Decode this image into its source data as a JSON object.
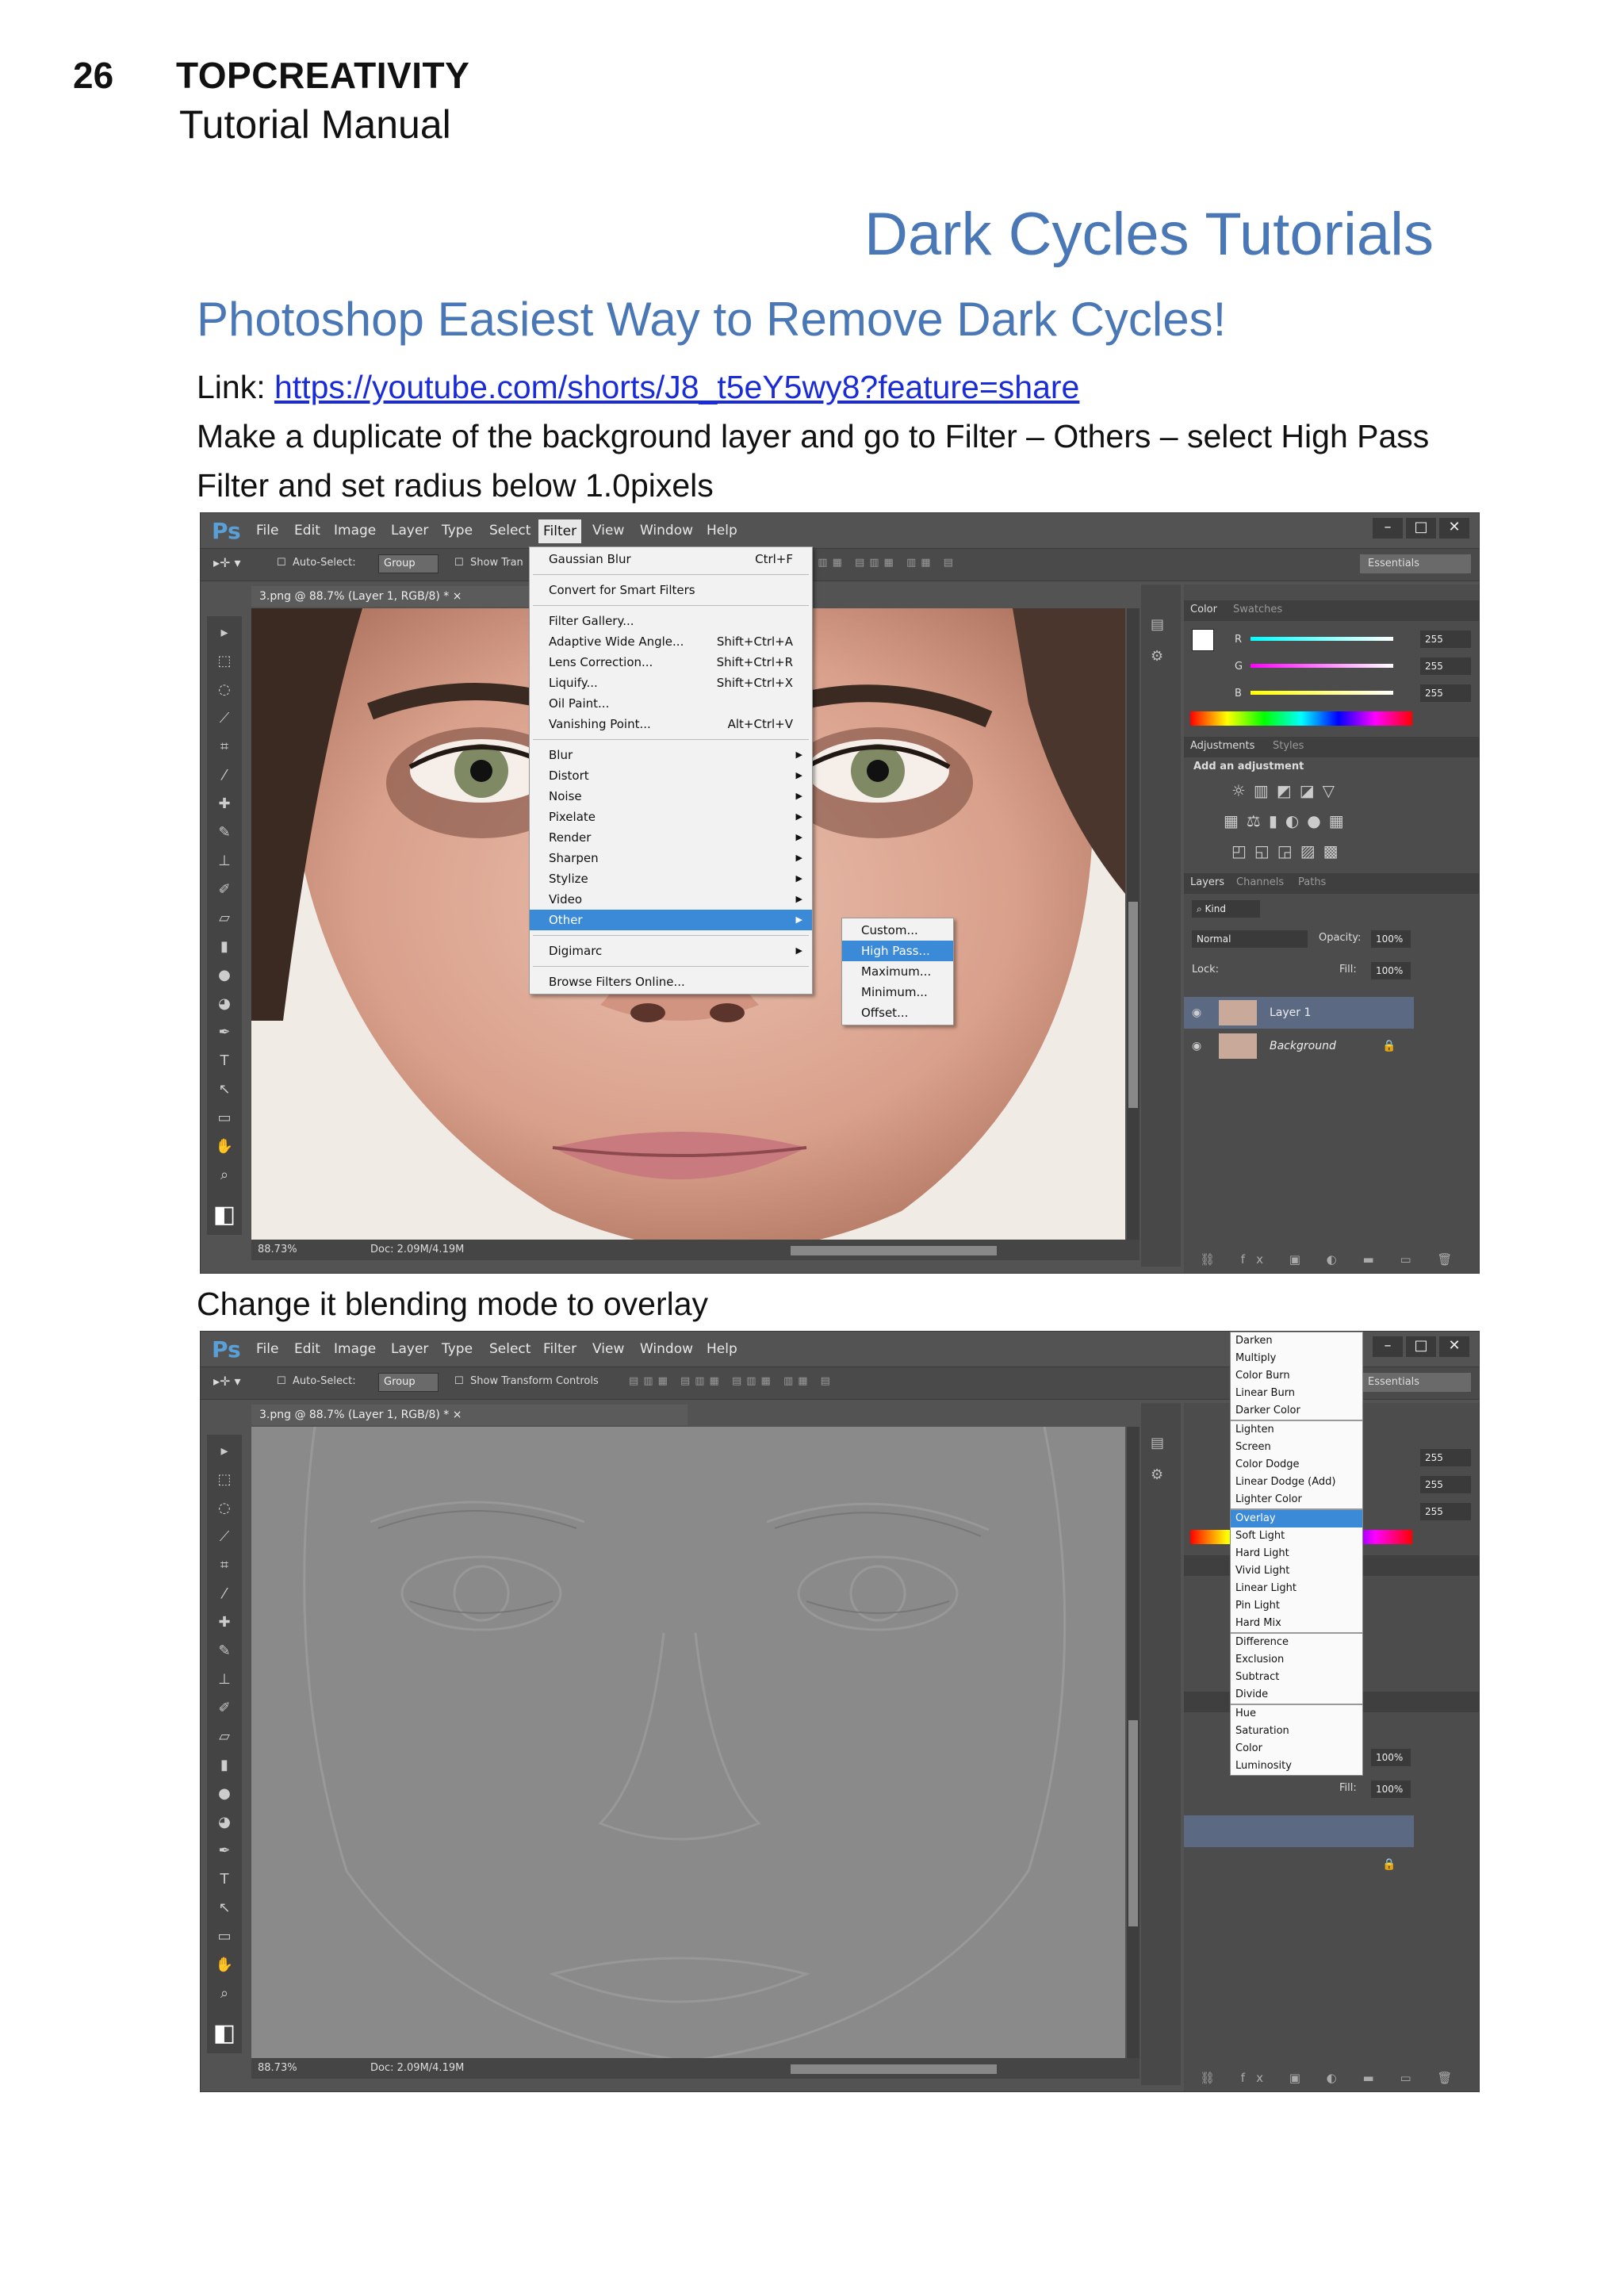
{
  "page": {
    "number": "26",
    "brand": "TOPCREATIVITY",
    "subtitle": "Tutorial Manual",
    "section_title": "Dark Cycles Tutorials",
    "article_title": "Photoshop Easiest Way to Remove Dark Cycles!",
    "link_label": "Link: ",
    "link_url": "https://youtube.com/shorts/J8_t5eY5wy8?feature=share",
    "step1_line1": "Make a duplicate of the background layer and go to Filter – Others – select High Pass",
    "step1_line2": "Filter and set radius below 1.0pixels",
    "step2": "Change it blending mode to overlay"
  },
  "ps": {
    "logo": "Ps",
    "menus": [
      "File",
      "Edit",
      "Image",
      "Layer",
      "Type",
      "Select",
      "Filter",
      "View",
      "Window",
      "Help"
    ],
    "window_buttons": [
      "–",
      "□",
      "✕"
    ],
    "options": {
      "auto_select": "Auto-Select:",
      "group": "Group",
      "show_transform": "Show Transform Controls",
      "show_trans_short": "Show Tran",
      "essentials": "Essentials"
    },
    "doc_tab": "3.png @ 88.7% (Layer 1, RGB/8) *",
    "zoom": "88.73%",
    "doc_size": "Doc: 2.09M/4.19M",
    "panels": {
      "color_tab": "Color",
      "swatches_tab": "Swatches",
      "rgb_labels": [
        "R",
        "G",
        "B"
      ],
      "rgb_values": [
        "255",
        "255",
        "255"
      ],
      "adjustments_tab": "Adjustments",
      "styles_tab": "Styles",
      "add_adjustment": "Add an adjustment",
      "layers_tab": "Layers",
      "channels_tab": "Channels",
      "paths_tab": "Paths",
      "kind": "Kind",
      "blend_mode": "Normal",
      "opacity_label": "Opacity:",
      "opacity": "100%",
      "lock_label": "Lock:",
      "fill_label": "Fill:",
      "fill": "100%",
      "layers": [
        "Layer 1",
        "Background"
      ]
    },
    "filter_menu": {
      "items": [
        {
          "label": "Gaussian Blur",
          "shortcut": "Ctrl+F"
        },
        {
          "sep": true
        },
        {
          "label": "Convert for Smart Filters"
        },
        {
          "sep": true
        },
        {
          "label": "Filter Gallery..."
        },
        {
          "label": "Adaptive Wide Angle...",
          "shortcut": "Shift+Ctrl+A"
        },
        {
          "label": "Lens Correction...",
          "shortcut": "Shift+Ctrl+R"
        },
        {
          "label": "Liquify...",
          "shortcut": "Shift+Ctrl+X"
        },
        {
          "label": "Oil Paint..."
        },
        {
          "label": "Vanishing Point...",
          "shortcut": "Alt+Ctrl+V"
        },
        {
          "sep": true
        },
        {
          "label": "Blur",
          "sub": true
        },
        {
          "label": "Distort",
          "sub": true
        },
        {
          "label": "Noise",
          "sub": true
        },
        {
          "label": "Pixelate",
          "sub": true
        },
        {
          "label": "Render",
          "sub": true
        },
        {
          "label": "Sharpen",
          "sub": true
        },
        {
          "label": "Stylize",
          "sub": true
        },
        {
          "label": "Video",
          "sub": true
        },
        {
          "label": "Other",
          "sub": true,
          "hl": true
        },
        {
          "sep": true
        },
        {
          "label": "Digimarc",
          "sub": true
        },
        {
          "sep": true
        },
        {
          "label": "Browse Filters Online..."
        }
      ],
      "other_submenu": [
        {
          "label": "Custom..."
        },
        {
          "label": "High Pass...",
          "hl": true
        },
        {
          "label": "Maximum..."
        },
        {
          "label": "Minimum..."
        },
        {
          "label": "Offset..."
        }
      ]
    },
    "blend_menu": [
      {
        "label": "Darken"
      },
      {
        "label": "Multiply"
      },
      {
        "label": "Color Burn"
      },
      {
        "label": "Linear Burn"
      },
      {
        "label": "Darker Color"
      },
      {
        "sep": true
      },
      {
        "label": "Lighten"
      },
      {
        "label": "Screen"
      },
      {
        "label": "Color Dodge"
      },
      {
        "label": "Linear Dodge (Add)"
      },
      {
        "label": "Lighter Color"
      },
      {
        "sep": true
      },
      {
        "label": "Overlay",
        "hl": true
      },
      {
        "label": "Soft Light"
      },
      {
        "label": "Hard Light"
      },
      {
        "label": "Vivid Light"
      },
      {
        "label": "Linear Light"
      },
      {
        "label": "Pin Light"
      },
      {
        "label": "Hard Mix"
      },
      {
        "sep": true
      },
      {
        "label": "Difference"
      },
      {
        "label": "Exclusion"
      },
      {
        "label": "Subtract"
      },
      {
        "label": "Divide"
      },
      {
        "sep": true
      },
      {
        "label": "Hue"
      },
      {
        "label": "Saturation"
      },
      {
        "label": "Color"
      },
      {
        "label": "Luminosity"
      }
    ],
    "colors": {
      "ui_dark": "#535353",
      "accent": "#3b8ad8",
      "heading": "#4a78b6",
      "link": "#1a2cd8"
    }
  }
}
